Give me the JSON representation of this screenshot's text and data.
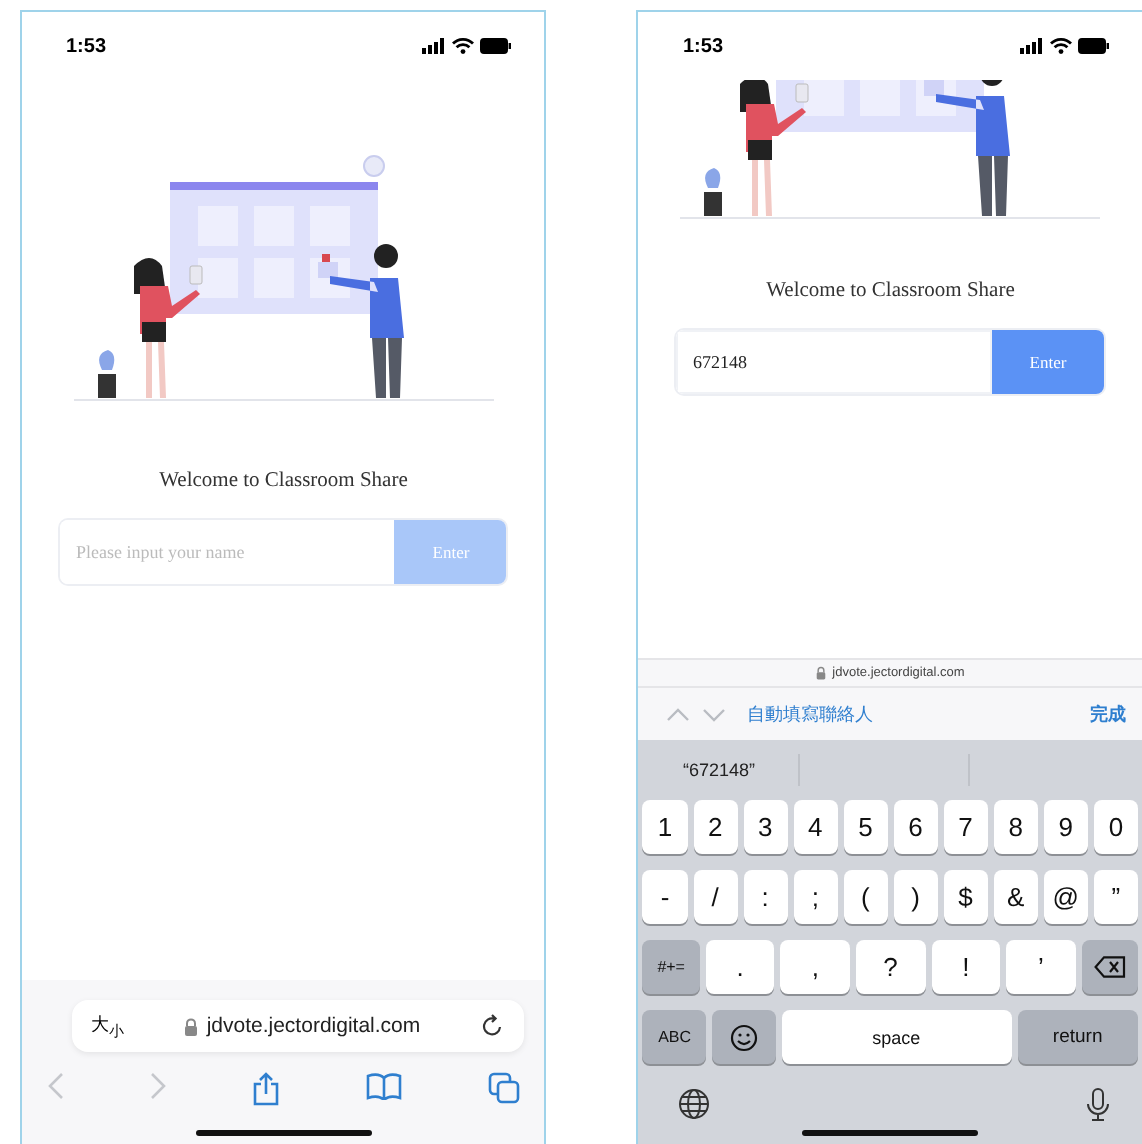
{
  "left_screen": {
    "status_time": "1:53",
    "welcome": "Welcome to Classroom Share",
    "name_field": {
      "placeholder": "Please input your name",
      "focused": false
    },
    "enter_button": {
      "label": "Enter",
      "disabled": true
    },
    "address_bar": {
      "text_size": "大$_{小}$",
      "url": "jdvote.jectordigital.com"
    },
    "toolbar": [
      {
        "kind": "back",
        "disabled": true
      },
      {
        "kind": "forward",
        "disabled": true
      },
      {
        "kind": "share",
        "disabled": false
      },
      {
        "kind": "bookmarks",
        "disabled": false
      },
      {
        "kind": "tabs",
        "disabled": false
      }
    ]
  },
  "right_screen": {
    "status_time": "1:53",
    "welcome": "Welcome to Classroom Share",
    "name_field": {
      "value": "672148",
      "focused": true
    },
    "enter_button": {
      "label": "Enter",
      "disabled": false
    },
    "url": "jdvote.jectordigital.com",
    "accessory": {
      "nav": [
        {
          "kind": "up",
          "disabled": true
        },
        {
          "kind": "down",
          "disabled": true
        }
      ],
      "autofill": "自動填寫聯絡人",
      "done": "完成"
    },
    "suggestion": "“672148”",
    "key_rows": [
      [
        {
          "kind": "char",
          "label": "1"
        },
        {
          "kind": "char",
          "label": "2"
        },
        {
          "kind": "char",
          "label": "3"
        },
        {
          "kind": "char",
          "label": "4"
        },
        {
          "kind": "char",
          "label": "5"
        },
        {
          "kind": "char",
          "label": "6"
        },
        {
          "kind": "char",
          "label": "7"
        },
        {
          "kind": "char",
          "label": "8"
        },
        {
          "kind": "char",
          "label": "9"
        },
        {
          "kind": "char",
          "label": "0"
        }
      ],
      [
        {
          "kind": "char",
          "label": "-"
        },
        {
          "kind": "char",
          "label": "/"
        },
        {
          "kind": "char",
          "label": ":"
        },
        {
          "kind": "char",
          "label": ";"
        },
        {
          "kind": "char",
          "label": "("
        },
        {
          "kind": "char",
          "label": ")"
        },
        {
          "kind": "char",
          "label": "$"
        },
        {
          "kind": "char",
          "label": "&"
        },
        {
          "kind": "char",
          "label": "@"
        },
        {
          "kind": "char",
          "label": "”"
        }
      ],
      [
        {
          "kind": "mod",
          "label": "#+="
        },
        {
          "kind": "wide",
          "label": "."
        },
        {
          "kind": "wide",
          "label": ","
        },
        {
          "kind": "wide",
          "label": "?"
        },
        {
          "kind": "wide",
          "label": "!"
        },
        {
          "kind": "wide",
          "label": "’"
        },
        {
          "kind": "backspace"
        }
      ],
      [
        {
          "kind": "mod",
          "label": "ABC"
        },
        {
          "kind": "emoji"
        },
        {
          "kind": "space",
          "label": "space"
        },
        {
          "kind": "return",
          "label": "return"
        }
      ]
    ]
  }
}
